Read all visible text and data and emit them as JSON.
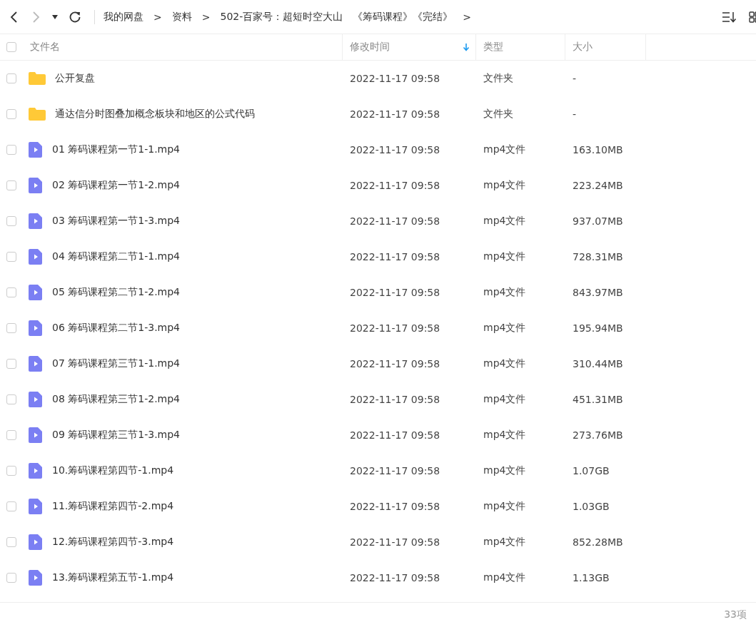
{
  "toolbar": {
    "breadcrumb": [
      {
        "label": "我的网盘"
      },
      {
        "label": ">"
      },
      {
        "label": "资料"
      },
      {
        "label": ">"
      },
      {
        "label": "502-百家号：超短时空大山　《筹码课程》《完结》"
      },
      {
        "label": ">"
      }
    ]
  },
  "table": {
    "select_all": {
      "checked": false
    },
    "columns": [
      {
        "label": "文件名",
        "sorted": false
      },
      {
        "label": "修改时间",
        "sorted": true
      },
      {
        "label": "类型",
        "sorted": false
      },
      {
        "label": "大小",
        "sorted": false
      }
    ],
    "rows": [
      {
        "kind": "folder",
        "checked": false,
        "name": "公开复盘",
        "modified": "2022-11-17 09:58",
        "type": "文件夹",
        "size": "-"
      },
      {
        "kind": "folder",
        "checked": false,
        "name": "通达信分时图叠加概念板块和地区的公式代码",
        "modified": "2022-11-17 09:58",
        "type": "文件夹",
        "size": "-"
      },
      {
        "kind": "video",
        "checked": false,
        "name": "01 筹码课程第一节1-1.mp4",
        "modified": "2022-11-17 09:58",
        "type": "mp4文件",
        "size": "163.10MB"
      },
      {
        "kind": "video",
        "checked": false,
        "name": "02 筹码课程第一节1-2.mp4",
        "modified": "2022-11-17 09:58",
        "type": "mp4文件",
        "size": "223.24MB"
      },
      {
        "kind": "video",
        "checked": false,
        "name": "03 筹码课程第一节1-3.mp4",
        "modified": "2022-11-17 09:58",
        "type": "mp4文件",
        "size": "937.07MB"
      },
      {
        "kind": "video",
        "checked": false,
        "name": "04 筹码课程第二节1-1.mp4",
        "modified": "2022-11-17 09:58",
        "type": "mp4文件",
        "size": "728.31MB"
      },
      {
        "kind": "video",
        "checked": false,
        "name": "05 筹码课程第二节1-2.mp4",
        "modified": "2022-11-17 09:58",
        "type": "mp4文件",
        "size": "843.97MB"
      },
      {
        "kind": "video",
        "checked": false,
        "name": "06 筹码课程第二节1-3.mp4",
        "modified": "2022-11-17 09:58",
        "type": "mp4文件",
        "size": "195.94MB"
      },
      {
        "kind": "video",
        "checked": false,
        "name": "07 筹码课程第三节1-1.mp4",
        "modified": "2022-11-17 09:58",
        "type": "mp4文件",
        "size": "310.44MB"
      },
      {
        "kind": "video",
        "checked": false,
        "name": "08 筹码课程第三节1-2.mp4",
        "modified": "2022-11-17 09:58",
        "type": "mp4文件",
        "size": "451.31MB"
      },
      {
        "kind": "video",
        "checked": false,
        "name": "09 筹码课程第三节1-3.mp4",
        "modified": "2022-11-17 09:58",
        "type": "mp4文件",
        "size": "273.76MB"
      },
      {
        "kind": "video",
        "checked": false,
        "name": "10.筹码课程第四节-1.mp4",
        "modified": "2022-11-17 09:58",
        "type": "mp4文件",
        "size": "1.07GB"
      },
      {
        "kind": "video",
        "checked": false,
        "name": "11.筹码课程第四节-2.mp4",
        "modified": "2022-11-17 09:58",
        "type": "mp4文件",
        "size": "1.03GB"
      },
      {
        "kind": "video",
        "checked": false,
        "name": "12.筹码课程第四节-3.mp4",
        "modified": "2022-11-17 09:58",
        "type": "mp4文件",
        "size": "852.28MB"
      },
      {
        "kind": "video",
        "checked": false,
        "name": "13.筹码课程第五节-1.mp4",
        "modified": "2022-11-17 09:58",
        "type": "mp4文件",
        "size": "1.13GB"
      }
    ]
  },
  "status_bar": {
    "count": "33项"
  }
}
